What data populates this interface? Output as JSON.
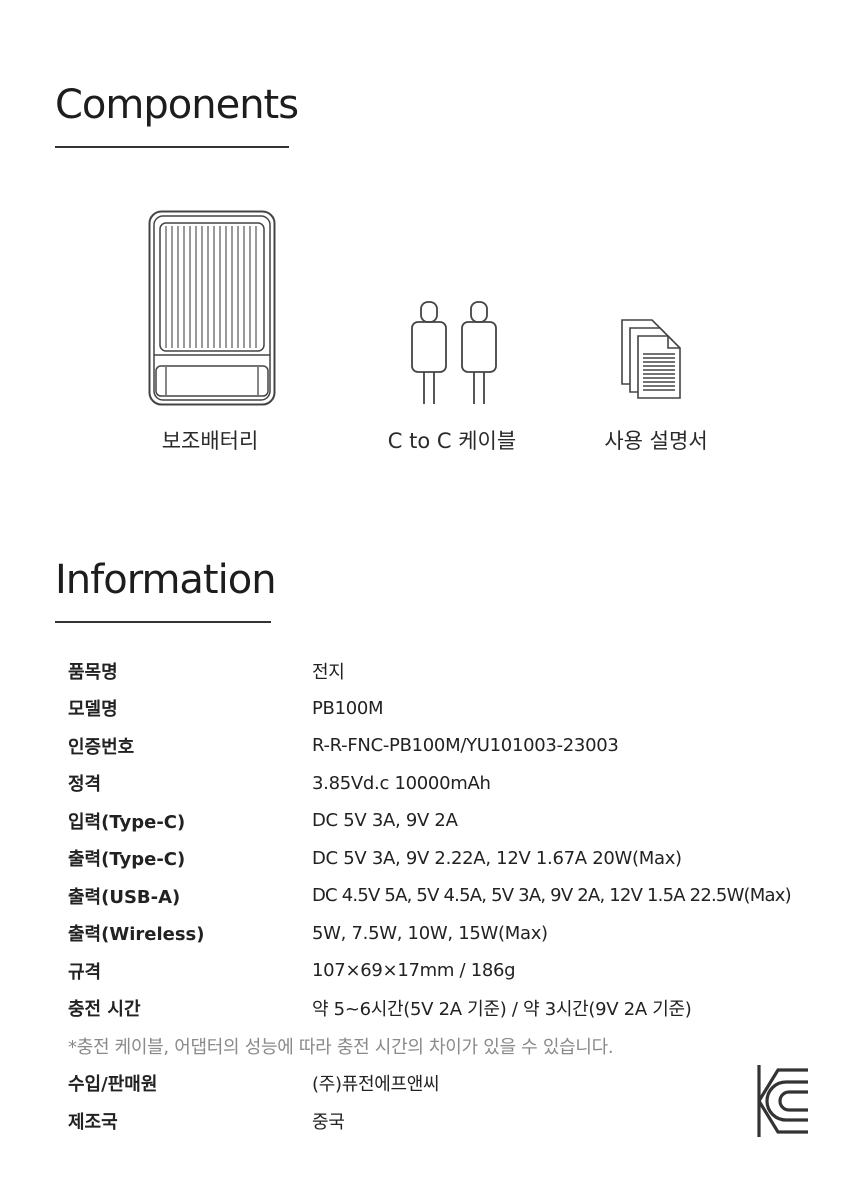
{
  "components": {
    "title": "Components",
    "items": [
      {
        "label": "보조배터리",
        "icon": "power-bank-icon"
      },
      {
        "label": "C to C 케이블",
        "icon": "usb-c-cable-icon"
      },
      {
        "label": "사용 설명서",
        "icon": "manual-documents-icon"
      }
    ]
  },
  "information": {
    "title": "Information",
    "rows": [
      {
        "key": "품목명",
        "value": "전지"
      },
      {
        "key": "모델명",
        "value": "PB100M"
      },
      {
        "key": "인증번호",
        "value": "R-R-FNC-PB100M/YU101003-23003"
      },
      {
        "key": "정격",
        "value": "3.85Vd.c 10000mAh"
      },
      {
        "key": "입력(Type-C)",
        "value": "DC 5V 3A, 9V 2A"
      },
      {
        "key": "출력(Type-C)",
        "value": "DC 5V 3A, 9V 2.22A, 12V 1.67A 20W(Max)"
      },
      {
        "key": "출력(USB-A)",
        "value": "DC 4.5V 5A, 5V 4.5A, 5V 3A, 9V 2A, 12V 1.5A 22.5W(Max)"
      },
      {
        "key": "출력(Wireless)",
        "value": "5W, 7.5W, 10W, 15W(Max)"
      },
      {
        "key": "규격",
        "value": "107×69×17mm / 186g"
      },
      {
        "key": "충전 시간",
        "value": "약 5~6시간(5V 2A 기준) / 약 3시간(9V 2A 기준)"
      }
    ],
    "note": "*충전 케이블, 어댑터의 성능에 따라 충전 시간의 차이가 있을 수 있습니다.",
    "rows_after": [
      {
        "key": "수입/판매원",
        "value": "(주)퓨전에프앤씨"
      },
      {
        "key": "제조국",
        "value": "중국"
      }
    ]
  },
  "certification": {
    "icon": "kc-certification-mark-icon"
  },
  "colors": {
    "text": "#222222",
    "note": "#8a8a8a",
    "icon_stroke": "#444444",
    "rule": "#333333"
  }
}
